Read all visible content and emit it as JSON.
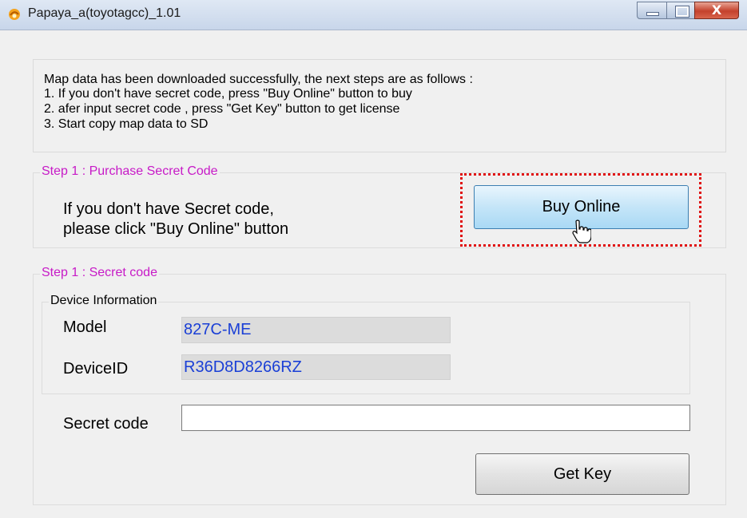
{
  "window": {
    "title": "Papaya_a(toyotagcc)_1.01",
    "close_glyph": "X"
  },
  "info": {
    "lines": [
      "Map data has been downloaded successfully, the next steps are as follows :",
      "1. If you don't have secret code, press \"Buy Online\" button to buy",
      "2. afer input secret code , press \"Get Key\" button to get license",
      "3. Start copy map data to SD"
    ]
  },
  "step1_purchase": {
    "legend": "Step 1 : Purchase Secret Code",
    "message_line1": "If you don't have Secret code,",
    "message_line2": "please click \"Buy Online\" button",
    "buy_button": "Buy Online"
  },
  "step1_secret": {
    "legend": "Step 1 : Secret code",
    "device_info": {
      "legend": "Device Information",
      "model_label": "Model",
      "model_value": "827C-ME",
      "device_id_label": "DeviceID",
      "device_id_value": "R36D8D8266RZ"
    },
    "secret_code_label": "Secret code",
    "secret_code_value": "",
    "get_key_button": "Get Key"
  },
  "colors": {
    "legend": "#c71ac7",
    "readonly_text": "#1a3fd6",
    "highlight": "#e01010"
  },
  "icons": [
    "app-icon",
    "minimize-icon",
    "maximize-icon",
    "close-icon",
    "hand-cursor-icon"
  ]
}
